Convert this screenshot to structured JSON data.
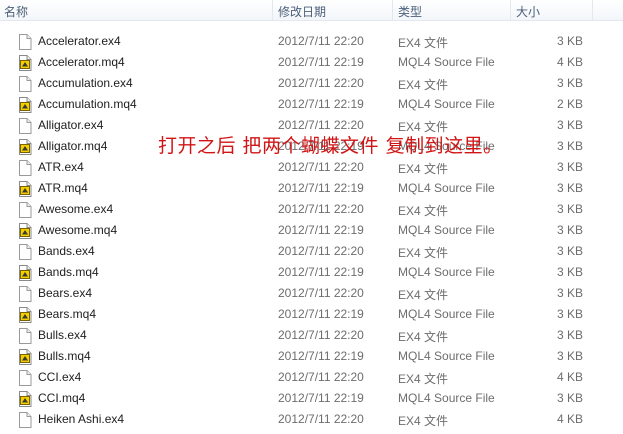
{
  "columns": {
    "name": "名称",
    "date": "修改日期",
    "type": "类型",
    "size": "大小"
  },
  "files": [
    {
      "name": "Accelerator.ex4",
      "date": "2012/7/11 22:20",
      "type": "EX4 文件",
      "size": "3 KB",
      "icon": "blank-file-icon"
    },
    {
      "name": "Accelerator.mq4",
      "date": "2012/7/11 22:19",
      "type": "MQL4 Source File",
      "size": "4 KB",
      "icon": "mq4-file-icon"
    },
    {
      "name": "Accumulation.ex4",
      "date": "2012/7/11 22:20",
      "type": "EX4 文件",
      "size": "3 KB",
      "icon": "blank-file-icon"
    },
    {
      "name": "Accumulation.mq4",
      "date": "2012/7/11 22:19",
      "type": "MQL4 Source File",
      "size": "2 KB",
      "icon": "mq4-file-icon"
    },
    {
      "name": "Alligator.ex4",
      "date": "2012/7/11 22:20",
      "type": "EX4 文件",
      "size": "3 KB",
      "icon": "blank-file-icon"
    },
    {
      "name": "Alligator.mq4",
      "date": "2012/7/11 22:19",
      "type": "MQL4 Source File",
      "size": "3 KB",
      "icon": "mq4-file-icon"
    },
    {
      "name": "ATR.ex4",
      "date": "2012/7/11 22:20",
      "type": "EX4 文件",
      "size": "3 KB",
      "icon": "blank-file-icon"
    },
    {
      "name": "ATR.mq4",
      "date": "2012/7/11 22:19",
      "type": "MQL4 Source File",
      "size": "3 KB",
      "icon": "mq4-file-icon"
    },
    {
      "name": "Awesome.ex4",
      "date": "2012/7/11 22:20",
      "type": "EX4 文件",
      "size": "3 KB",
      "icon": "blank-file-icon"
    },
    {
      "name": "Awesome.mq4",
      "date": "2012/7/11 22:19",
      "type": "MQL4 Source File",
      "size": "3 KB",
      "icon": "mq4-file-icon"
    },
    {
      "name": "Bands.ex4",
      "date": "2012/7/11 22:20",
      "type": "EX4 文件",
      "size": "3 KB",
      "icon": "blank-file-icon"
    },
    {
      "name": "Bands.mq4",
      "date": "2012/7/11 22:19",
      "type": "MQL4 Source File",
      "size": "3 KB",
      "icon": "mq4-file-icon"
    },
    {
      "name": "Bears.ex4",
      "date": "2012/7/11 22:20",
      "type": "EX4 文件",
      "size": "3 KB",
      "icon": "blank-file-icon"
    },
    {
      "name": "Bears.mq4",
      "date": "2012/7/11 22:19",
      "type": "MQL4 Source File",
      "size": "3 KB",
      "icon": "mq4-file-icon"
    },
    {
      "name": "Bulls.ex4",
      "date": "2012/7/11 22:20",
      "type": "EX4 文件",
      "size": "3 KB",
      "icon": "blank-file-icon"
    },
    {
      "name": "Bulls.mq4",
      "date": "2012/7/11 22:19",
      "type": "MQL4 Source File",
      "size": "3 KB",
      "icon": "mq4-file-icon"
    },
    {
      "name": "CCI.ex4",
      "date": "2012/7/11 22:20",
      "type": "EX4 文件",
      "size": "4 KB",
      "icon": "blank-file-icon"
    },
    {
      "name": "CCI.mq4",
      "date": "2012/7/11 22:19",
      "type": "MQL4 Source File",
      "size": "3 KB",
      "icon": "mq4-file-icon"
    },
    {
      "name": "Heiken Ashi.ex4",
      "date": "2012/7/11 22:20",
      "type": "EX4 文件",
      "size": "4 KB",
      "icon": "blank-file-icon"
    }
  ],
  "annotation": "打开之后 把两个蝴蝶文件 复制到这里。",
  "colors": {
    "annotation": "#d21414",
    "header_text": "#4c607a",
    "mq4_icon": "#f4d000"
  }
}
